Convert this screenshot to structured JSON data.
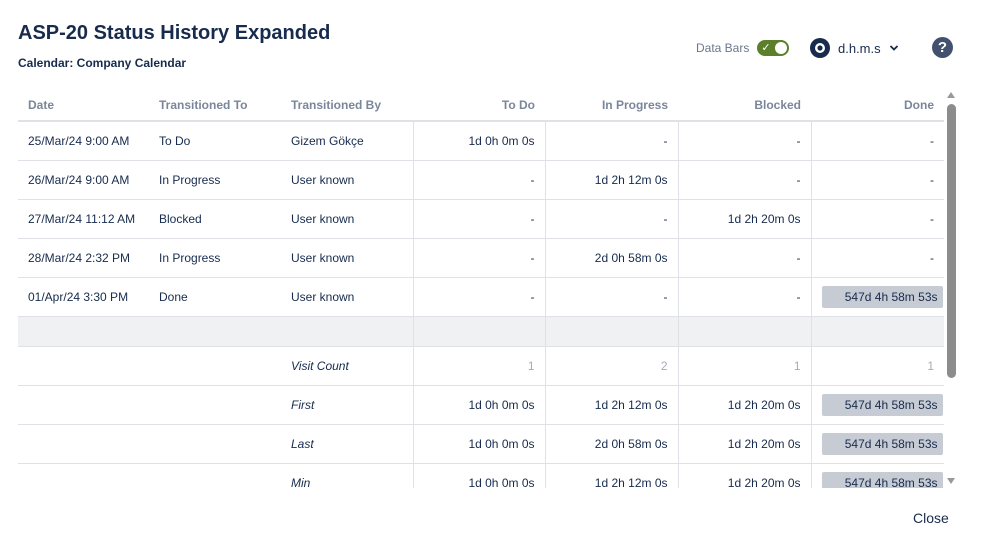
{
  "dialog": {
    "title": "ASP-20 Status History Expanded",
    "calendar": "Calendar: Company Calendar",
    "close_label": "Close"
  },
  "toolbar": {
    "data_bars_label": "Data Bars",
    "data_bars_on": true,
    "format_label": "d.h.m.s",
    "format_icon": "eye-icon",
    "help_label": "?"
  },
  "colors": {
    "toggle_on": "#5b7f2a",
    "bar_fill": "#c7ccd4",
    "header_text": "#7a869a"
  },
  "table": {
    "headers": {
      "date": "Date",
      "transitioned_to": "Transitioned To",
      "transitioned_by": "Transitioned By",
      "todo": "To Do",
      "in_progress": "In Progress",
      "blocked": "Blocked",
      "done": "Done"
    },
    "rows": [
      {
        "date": "25/Mar/24 9:00 AM",
        "to": "To Do",
        "by": "Gizem Gökçe",
        "todo": "1d 0h 0m 0s",
        "in_progress": "-",
        "blocked": "-",
        "done": "-"
      },
      {
        "date": "26/Mar/24 9:00 AM",
        "to": "In Progress",
        "by": "User known",
        "todo": "-",
        "in_progress": "1d 2h 12m 0s",
        "blocked": "-",
        "done": "-"
      },
      {
        "date": "27/Mar/24 11:12 AM",
        "to": "Blocked",
        "by": "User known",
        "todo": "-",
        "in_progress": "-",
        "blocked": "1d 2h 20m 0s",
        "done": "-"
      },
      {
        "date": "28/Mar/24 2:32 PM",
        "to": "In Progress",
        "by": "User known",
        "todo": "-",
        "in_progress": "2d 0h 58m 0s",
        "blocked": "-",
        "done": "-"
      },
      {
        "date": "01/Apr/24 3:30 PM",
        "to": "Done",
        "by": "User known",
        "todo": "-",
        "in_progress": "-",
        "blocked": "-",
        "done": "547d 4h 58m 53s"
      }
    ],
    "summary": [
      {
        "label": "Visit Count",
        "todo": "1",
        "in_progress": "2",
        "blocked": "1",
        "done": "1"
      },
      {
        "label": "First",
        "todo": "1d 0h 0m 0s",
        "in_progress": "1d 2h 12m 0s",
        "blocked": "1d 2h 20m 0s",
        "done": "547d 4h 58m 53s"
      },
      {
        "label": "Last",
        "todo": "1d 0h 0m 0s",
        "in_progress": "2d 0h 58m 0s",
        "blocked": "1d 2h 20m 0s",
        "done": "547d 4h 58m 53s"
      },
      {
        "label": "Min",
        "todo": "1d 0h 0m 0s",
        "in_progress": "1d 2h 12m 0s",
        "blocked": "1d 2h 20m 0s",
        "done": "547d 4h 58m 53s"
      }
    ]
  }
}
